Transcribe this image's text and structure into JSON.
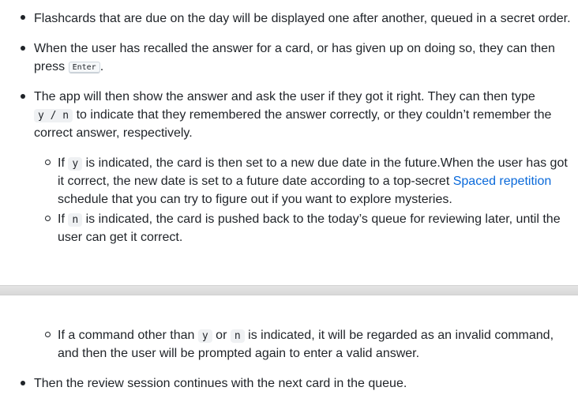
{
  "bullets": {
    "b1": "Flashcards that are due on the day will be displayed one after another, queued in a secret order.",
    "b2_l1": "When the user has recalled the answer for a card, or has given up on doing so, they can then",
    "b2_l2_pre": "press",
    "b2_key": "Enter",
    "b2_l2_post": ".",
    "b3_l1": "The app will then show the answer and ask the user if they got it right. They can then type",
    "b3_code": "y / n",
    "b3_l2_post": "to indicate that they remembered the answer correctly, or they couldn’t remember the",
    "b3_l3": "correct answer, respectively.",
    "b6": "Then the review session continues with the next card in the queue."
  },
  "sub": {
    "s1_pre": "If",
    "s1_code": "y",
    "s1_l1_post": "is indicated, the card is then set to a new due date in the future.When the user has got",
    "s1_l2_pre": "it correct, the new date is set to a future date according to a top-secret",
    "s1_link": "Spaced repetition",
    "s1_l3": "schedule that you can try to figure out if you want to explore mysteries.",
    "s2_pre": "If",
    "s2_code": "n",
    "s2_l1_post": "is indicated, the card is pushed back to the today’s queue for reviewing later, until the",
    "s2_l2": "user can get it correct.",
    "s3_pre": "If a command other than",
    "s3_code1": "y",
    "s3_mid": "or",
    "s3_code2": "n",
    "s3_l1_post": "is indicated, it will be regarded as an invalid command,",
    "s3_l2": "and then the user will be prompted again to enter a valid answer."
  }
}
